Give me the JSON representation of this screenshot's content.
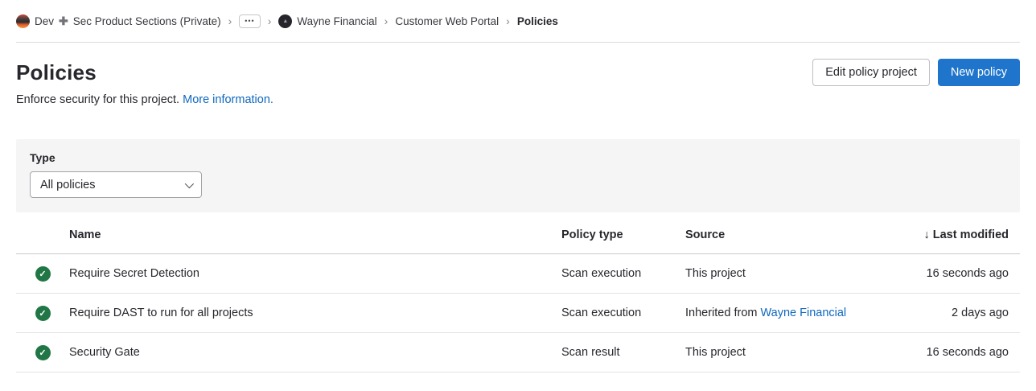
{
  "breadcrumb": {
    "group_prefix": "Dev",
    "plus": "✚",
    "group_suffix": "Sec Product Sections (Private)",
    "separator": "›",
    "ellipsis": "•••",
    "parent_group": "Wayne Financial",
    "project": "Customer Web Portal",
    "current": "Policies",
    "project_avatar_glyph": "▲"
  },
  "header": {
    "title": "Policies",
    "description": "Enforce security for this project.",
    "more_info_link": "More information.",
    "edit_button": "Edit policy project",
    "new_button": "New policy"
  },
  "filter": {
    "label": "Type",
    "selected_value": "All policies"
  },
  "table": {
    "columns": {
      "name": "Name",
      "policy_type": "Policy type",
      "source": "Source",
      "last_modified": "Last modified"
    },
    "sort_icon": "↓",
    "status_check": "✓",
    "rows": [
      {
        "status": "enabled",
        "name": "Require Secret Detection",
        "policy_type": "Scan execution",
        "source_text": "This project",
        "last_modified": "16 seconds ago"
      },
      {
        "status": "enabled",
        "name": "Require DAST to run for all projects",
        "policy_type": "Scan execution",
        "source_text": "Inherited from",
        "source_link": "Wayne Financial",
        "last_modified": "2 days ago"
      },
      {
        "status": "enabled",
        "name": "Security Gate",
        "policy_type": "Scan result",
        "source_text": "This project",
        "last_modified": "16 seconds ago"
      }
    ]
  },
  "colors": {
    "primary_button_blue": "#1f75cb",
    "link_blue": "#1068bf",
    "status_green": "#217645",
    "panel_gray": "#f5f5f5"
  }
}
